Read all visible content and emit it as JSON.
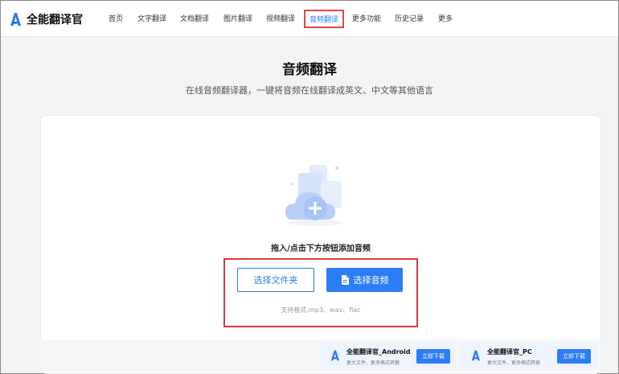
{
  "brand": {
    "name": "全能翻译官"
  },
  "nav": {
    "items": [
      {
        "label": "首页",
        "active": false
      },
      {
        "label": "文字翻译",
        "active": false
      },
      {
        "label": "文档翻译",
        "active": false
      },
      {
        "label": "图片翻译",
        "active": false
      },
      {
        "label": "视频翻译",
        "active": false
      },
      {
        "label": "音频翻译",
        "active": true
      },
      {
        "label": "更多功能",
        "active": false
      },
      {
        "label": "历史记录",
        "active": false
      },
      {
        "label": "更多",
        "active": false
      }
    ]
  },
  "main": {
    "title": "音频翻译",
    "subtitle": "在线音频翻译器，一键将音频在线翻译成英文、中文等其他语言",
    "drop_hint": "拖入/点击下方按钮添加音频",
    "select_folder_label": "选择文件夹",
    "select_audio_label": "选择音频",
    "formats": "支持格式:mp3、wav、flac"
  },
  "apps": [
    {
      "name": "全能翻译官_Android",
      "desc": "更大文件、更多格式转换",
      "download_label": "立即下载"
    },
    {
      "name": "全能翻译官_PC",
      "desc": "更大文件、更多格式转换",
      "download_label": "立即下载"
    }
  ],
  "colors": {
    "accent": "#2c7cf6",
    "highlight": "#d93b3b"
  },
  "icons": {
    "logo": "a-logo-icon",
    "upload": "cloud-plus-icon",
    "document": "document-icon"
  }
}
